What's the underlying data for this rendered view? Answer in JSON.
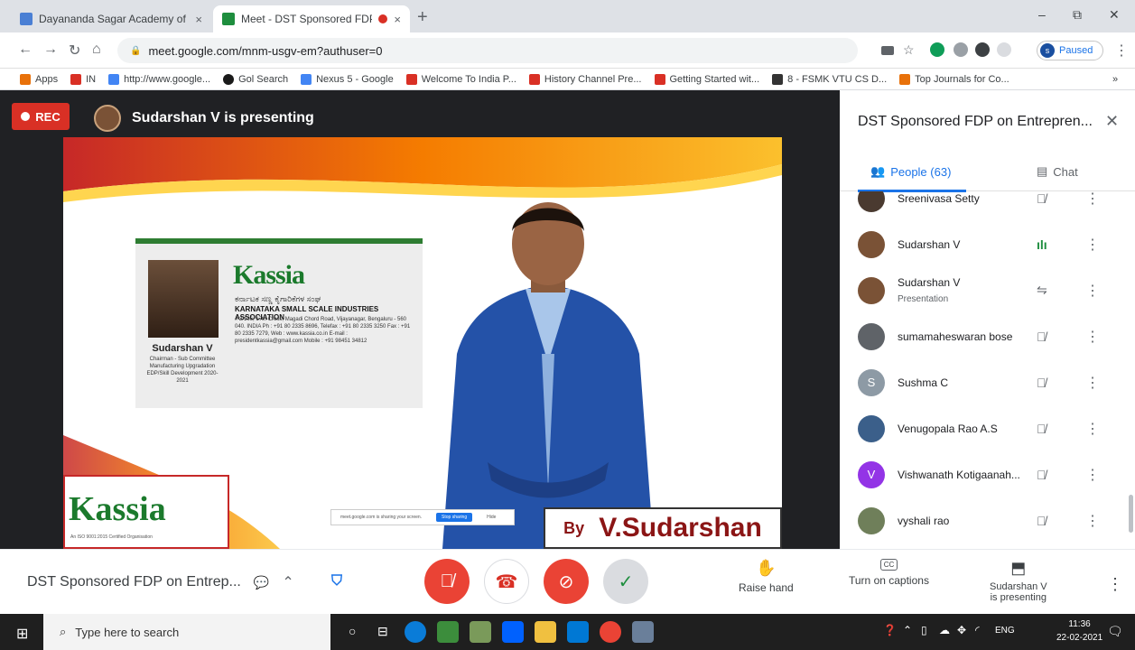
{
  "browser": {
    "tabs": [
      {
        "title": "Dayananda Sagar Academy of Te",
        "close": "×",
        "color": "#4a7fd4"
      },
      {
        "title": "Meet - DST Sponsored FDP",
        "close": "×",
        "color": "#1e8e3e"
      }
    ],
    "new_tab": "+",
    "window_controls": [
      "–",
      "⧉",
      "✕"
    ],
    "url": "meet.google.com/mnm-usgv-em?authuser=0",
    "profile_initial": "s",
    "profile_status": "Paused",
    "bookmarks": [
      {
        "label": "Apps",
        "color": "#e8710a"
      },
      {
        "label": "IN",
        "color": "#d93025"
      },
      {
        "label": "http://www.google...",
        "color": "#4285f4"
      },
      {
        "label": "Gol Search",
        "color": "#1a1a1a"
      },
      {
        "label": "Nexus 5 - Google",
        "color": "#4285f4"
      },
      {
        "label": "Welcome To India P...",
        "color": "#d93025"
      },
      {
        "label": "History Channel Pre...",
        "color": "#d93025"
      },
      {
        "label": "Getting Started wit...",
        "color": "#d93025"
      },
      {
        "label": "8 - FSMK VTU CS D...",
        "color": "#333333"
      },
      {
        "label": "Top Journals for Co...",
        "color": "#e8710a"
      }
    ],
    "bookmarks_more": "»"
  },
  "stage": {
    "rec_label": "REC",
    "presenting": "Sudarshan V is presenting"
  },
  "slide": {
    "card_logo": "Kassia",
    "card_name": "Sudarshan V",
    "card_caption": "Chairman - Sub Committee Manufacturing Upgradation EDP/Skill Development 2020-2021",
    "card_kannada": "ಕರ್ನಾಟಕ ಸಣ್ಣ ಕೈಗಾರಿಕೆಗಳ ಸಂಘ",
    "card_assoc": "KARNATAKA SMALL SCALE INDUSTRIES ASSOCIATION",
    "card_address": "# 2/106, 17th Cross, Magadi Chord Road, Vijayanagar, Bengaluru - 560 040. INDIA Ph : +91 80 2335 8696, Telefax : +91 80 2335 3250 Fax : +91 80 2335 7279, Web : www.kassia.co.in E-mail : presidentkassia@gmail.com Mobile : +91 98451 34812",
    "badge_logo": "Kassia",
    "badge_sub": "An ISO 9001:2015 Certified Organisation",
    "share_text": "meet.google.com is sharing your screen.",
    "share_stop": "Stop sharing",
    "share_hide": "Hide",
    "by": "By",
    "by_name": "V.Sudarshan"
  },
  "panel": {
    "title": "DST Sponsored FDP on Entrepren...",
    "close": "✕",
    "people_tab": "People (63)",
    "chat_tab": "Chat",
    "people": [
      {
        "name": "Sreenivasa Setty",
        "sub": "",
        "initial": "",
        "color": "#4a3a30",
        "mic": "🎙"
      },
      {
        "name": "Sudarshan V",
        "sub": "",
        "initial": "",
        "color": "#7a5236",
        "mic": "ılı"
      },
      {
        "name": "Sudarshan V",
        "sub": "Presentation",
        "initial": "",
        "color": "#7a5236",
        "mic": "⇋"
      },
      {
        "name": "sumamaheswaran bose",
        "sub": "",
        "initial": "",
        "color": "#5f6368",
        "mic": "🎙"
      },
      {
        "name": "Sushma C",
        "sub": "",
        "initial": "S",
        "color": "#8d9aa5",
        "mic": "🎙"
      },
      {
        "name": "Venugopala Rao A.S",
        "sub": "",
        "initial": "",
        "color": "#3b5f8a",
        "mic": "🎙"
      },
      {
        "name": "Vishwanath Kotigaanah...",
        "sub": "",
        "initial": "V",
        "color": "#9334e6",
        "mic": "🎙"
      },
      {
        "name": "vyshali rao",
        "sub": "",
        "initial": "",
        "color": "#6f7f5a",
        "mic": "🎙"
      }
    ]
  },
  "bottom": {
    "meeting_title": "DST Sponsored FDP on Entrep...",
    "raise_hand": "Raise hand",
    "captions": "Turn on captions",
    "presenting_line1": "Sudarshan V",
    "presenting_line2": "is presenting"
  },
  "taskbar": {
    "search_placeholder": "Type here to search",
    "lang": "ENG",
    "time": "11:36",
    "date": "22-02-2021"
  }
}
